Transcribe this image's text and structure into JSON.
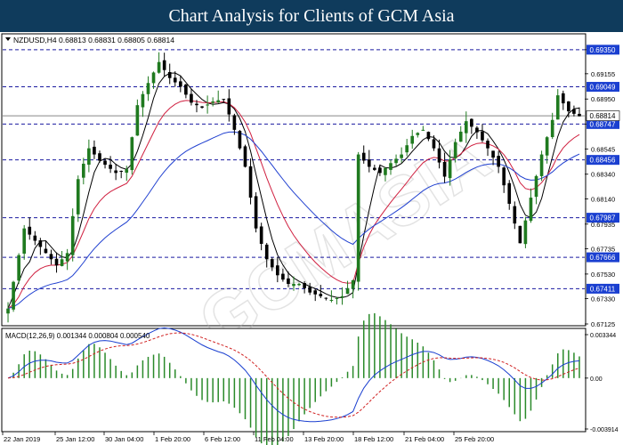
{
  "banner_title": "Chart Analysis for Clients of GCM Asia",
  "watermark": "GCMASIA",
  "chart_data": [
    {
      "type": "candlestick",
      "symbol_header": "NZDUSD,H4  0.68813 0.68831 0.68805 0.68814",
      "last_price": "0.68814",
      "ylim": [
        0.67125,
        0.6945
      ],
      "y_ticks": [
        "0.69350",
        "0.69155",
        "0.68950",
        "0.68747",
        "0.68545",
        "0.68340",
        "0.68140",
        "0.67935",
        "0.67735",
        "0.67530",
        "0.67330",
        "0.67125"
      ],
      "x_ticks": [
        "22 Jan 2019",
        "25 Jan 12:00",
        "30 Jan 04:00",
        "1 Feb 20:00",
        "6 Feb 12:00",
        "11 Feb 04:00",
        "13 Feb 20:00",
        "18 Feb 12:00",
        "21 Feb 04:00",
        "25 Feb 20:00"
      ],
      "horizontal_levels": [
        "0.69350",
        "0.69049",
        "0.68747",
        "0.68456",
        "0.67987",
        "0.67666",
        "0.67411"
      ],
      "colors": {
        "up": "#1f7a1f",
        "down": "#000000",
        "ma_fast": "#000000",
        "ma_mid": "#d02040",
        "ma_slow": "#2040d0",
        "level_line": "#1a1aa0",
        "level_label_bg": "#1a3fd0"
      },
      "anchors": [
        [
          0,
          0.6725
        ],
        [
          3,
          0.679
        ],
        [
          6,
          0.6775
        ],
        [
          9,
          0.676
        ],
        [
          11,
          0.677
        ],
        [
          13,
          0.683
        ],
        [
          15,
          0.6855
        ],
        [
          17,
          0.6845
        ],
        [
          20,
          0.6835
        ],
        [
          22,
          0.6838
        ],
        [
          24,
          0.689
        ],
        [
          26,
          0.6908
        ],
        [
          28,
          0.6925
        ],
        [
          30,
          0.6912
        ],
        [
          32,
          0.6905
        ],
        [
          34,
          0.6892
        ],
        [
          36,
          0.6888
        ],
        [
          38,
          0.6893
        ],
        [
          40,
          0.6895
        ],
        [
          42,
          0.687
        ],
        [
          44,
          0.684
        ],
        [
          46,
          0.679
        ],
        [
          48,
          0.6765
        ],
        [
          50,
          0.6752
        ],
        [
          52,
          0.6745
        ],
        [
          54,
          0.6745
        ],
        [
          56,
          0.6738
        ],
        [
          58,
          0.6735
        ],
        [
          60,
          0.6732
        ],
        [
          62,
          0.6735
        ],
        [
          64,
          0.6748
        ],
        [
          65,
          0.685
        ],
        [
          67,
          0.684
        ],
        [
          69,
          0.6835
        ],
        [
          71,
          0.6843
        ],
        [
          73,
          0.685
        ],
        [
          75,
          0.6865
        ],
        [
          77,
          0.687
        ],
        [
          79,
          0.6855
        ],
        [
          81,
          0.6832
        ],
        [
          83,
          0.686
        ],
        [
          85,
          0.6877
        ],
        [
          87,
          0.6868
        ],
        [
          89,
          0.6855
        ],
        [
          91,
          0.684
        ],
        [
          93,
          0.681
        ],
        [
          95,
          0.6778
        ],
        [
          97,
          0.6815
        ],
        [
          99,
          0.685
        ],
        [
          101,
          0.6878
        ],
        [
          102,
          0.6898
        ],
        [
          104,
          0.6885
        ],
        [
          106,
          0.6881
        ]
      ]
    },
    {
      "type": "macd",
      "label": "MACD(12,26,9) 0.001344 0.000804 0.000540",
      "ylim": [
        -0.003914,
        0.003344
      ],
      "y_ticks": [
        "0.003344",
        "0.00",
        "-0.003914"
      ],
      "colors": {
        "hist": "#2a8a2a",
        "macd": "#1a3fd0",
        "signal": "#d02020"
      }
    }
  ]
}
